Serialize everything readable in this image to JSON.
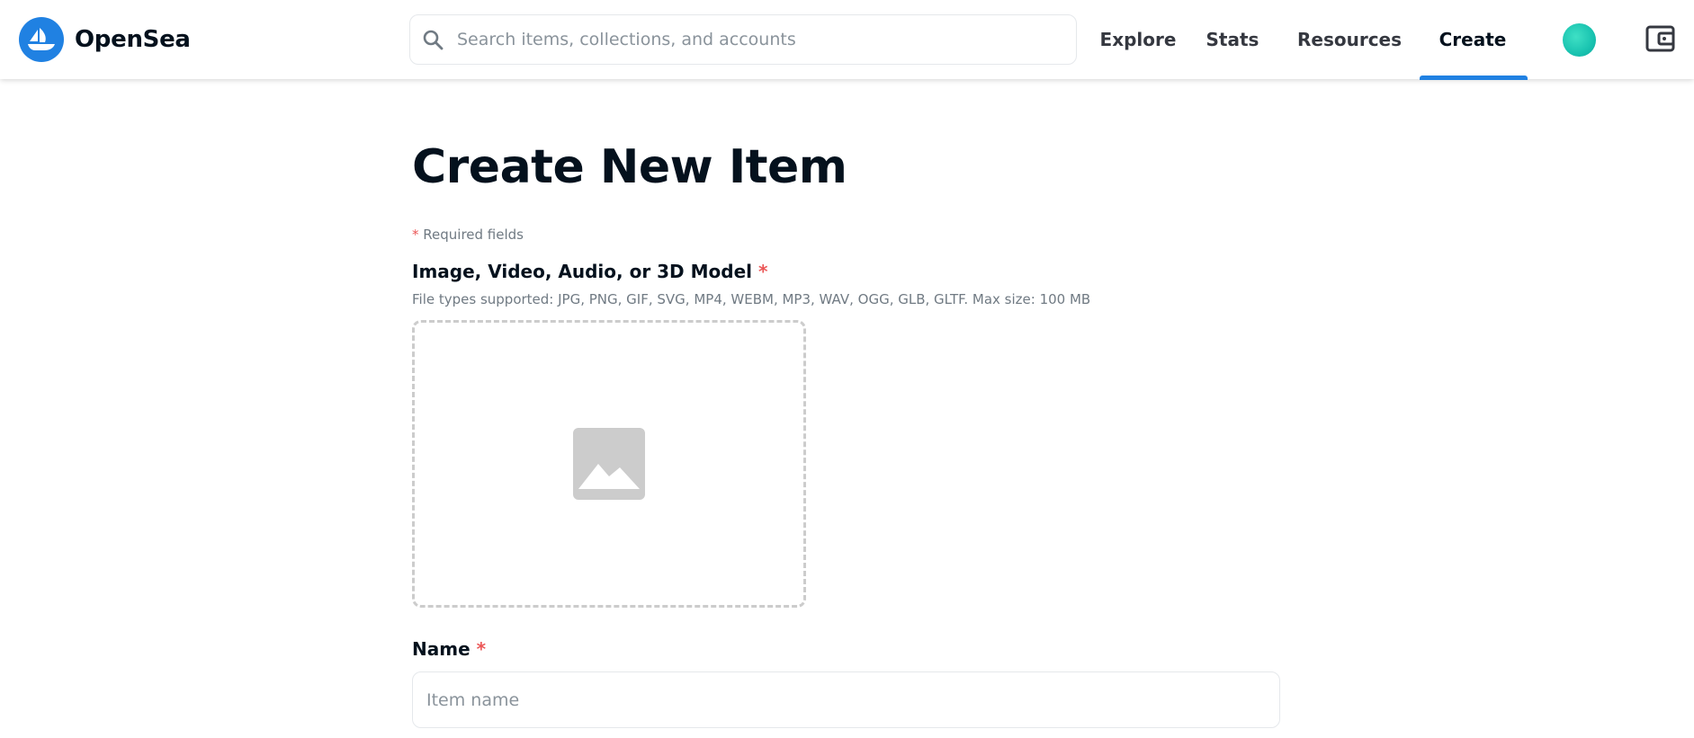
{
  "header": {
    "brand": "OpenSea",
    "search": {
      "placeholder": "Search items, collections, and accounts",
      "value": ""
    },
    "nav": [
      {
        "label": "Explore"
      },
      {
        "label": "Stats"
      },
      {
        "label": "Resources"
      },
      {
        "label": "Create",
        "active": true
      }
    ],
    "icons": {
      "logo": "opensea-ship-icon",
      "search": "search-icon",
      "avatar": "avatar",
      "wallet": "wallet-icon"
    },
    "colors": {
      "accent": "#2081e2",
      "avatar": "#19c3b0"
    }
  },
  "main": {
    "title": "Create New Item",
    "required_note": {
      "asterisk": "*",
      "text": " Required fields"
    },
    "media": {
      "label": "Image, Video, Audio, or 3D Model",
      "required_marker": "*",
      "file_types": "File types supported: JPG, PNG, GIF, SVG, MP4, WEBM, MP3, WAV, OGG, GLB, GLTF. Max size: 100 MB",
      "icon": "image-placeholder-icon"
    },
    "name": {
      "label": "Name",
      "required_marker": "*",
      "placeholder": "Item name",
      "value": ""
    }
  }
}
